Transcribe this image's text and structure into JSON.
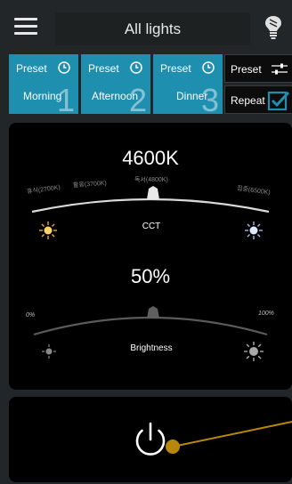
{
  "header": {
    "title": "All lights",
    "menu_icon": "hamburger-icon",
    "bulb_icon": "light-bulb-icon"
  },
  "presets": [
    {
      "label": "Preset",
      "name": "Morning",
      "number": "1"
    },
    {
      "label": "Preset",
      "name": "Afternoon",
      "number": "2"
    },
    {
      "label": "Preset",
      "name": "Dinner",
      "number": "3"
    }
  ],
  "side_controls": {
    "preset_label": "Preset",
    "repeat_label": "Repeat",
    "repeat_checked": true
  },
  "cct": {
    "value": "4600K",
    "caption": "CCT",
    "marks": [
      "휴식(2700K)",
      "활동(3700K)",
      "독서(4800K)",
      "집중(6500K)"
    ]
  },
  "brightness": {
    "value": "50%",
    "caption": "Brightness",
    "min_label": "0%",
    "max_label": "100%"
  },
  "power": {
    "icon": "power-icon",
    "slider_level": 0
  },
  "colors": {
    "preset_bg": "#1f8fb0",
    "accent_check": "#1f8fb0",
    "knob": "#b8860b"
  }
}
